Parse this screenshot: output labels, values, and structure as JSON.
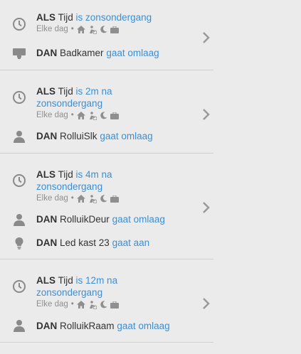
{
  "rules": [
    {
      "condition": {
        "keyword": "ALS",
        "subject": "Tijd",
        "value": "is zonsondergang",
        "repeat": "Elke dag"
      },
      "actions": [
        {
          "icon": "display-icon",
          "keyword": "DAN",
          "device": "Badkamer",
          "action": "gaat omlaag"
        }
      ]
    },
    {
      "condition": {
        "keyword": "ALS",
        "subject": "Tijd",
        "value": "is 2m na zonsondergang",
        "repeat": "Elke dag"
      },
      "actions": [
        {
          "icon": "person-icon",
          "keyword": "DAN",
          "device": "RolluiSlk",
          "action": "gaat omlaag"
        }
      ]
    },
    {
      "condition": {
        "keyword": "ALS",
        "subject": "Tijd",
        "value": "is 4m na zonsondergang",
        "repeat": "Elke dag"
      },
      "actions": [
        {
          "icon": "person-icon",
          "keyword": "DAN",
          "device": "RolluikDeur",
          "action": "gaat omlaag"
        },
        {
          "icon": "bulb-icon",
          "keyword": "DAN",
          "device": "Led kast 23",
          "action": "gaat aan"
        }
      ]
    },
    {
      "condition": {
        "keyword": "ALS",
        "subject": "Tijd",
        "value": "is 12m na zonsondergang",
        "repeat": "Elke dag"
      },
      "actions": [
        {
          "icon": "person-icon",
          "keyword": "DAN",
          "device": "RolluikRaam",
          "action": "gaat omlaag"
        }
      ]
    }
  ],
  "colors": {
    "accent": "#3b8fd6",
    "background": "#ebebeb",
    "muted": "#8f8f8f",
    "divider": "#cfcfcf"
  },
  "condition_icon": "clock-icon",
  "mode_icons": [
    "home-icon",
    "away-icon",
    "night-icon",
    "vacation-icon"
  ],
  "row_action_icon": "chevron-right-icon"
}
